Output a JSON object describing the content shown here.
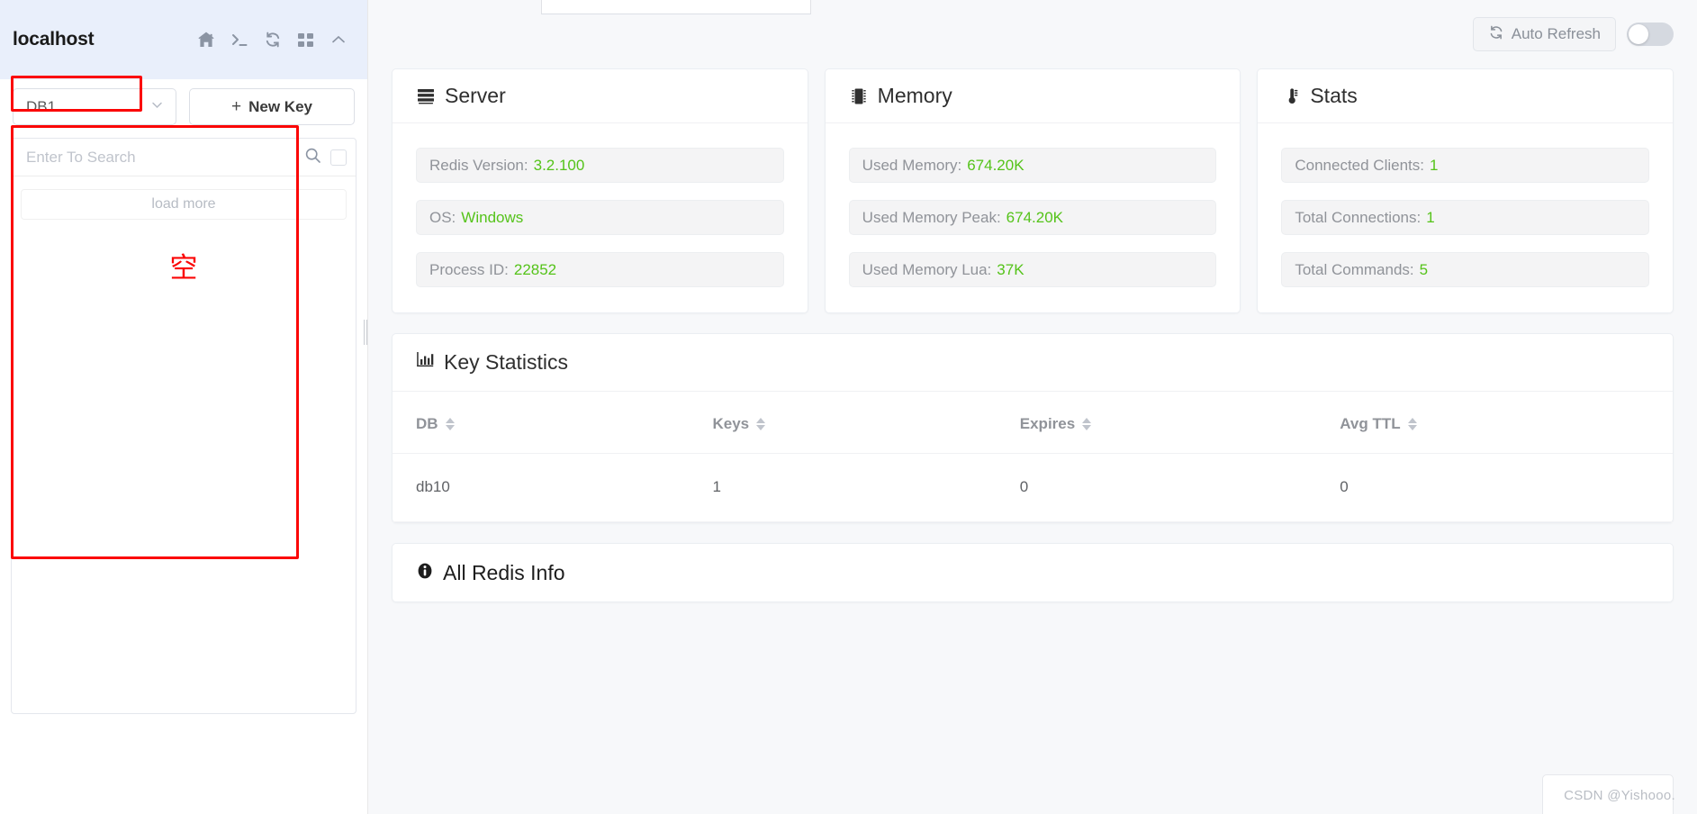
{
  "sidebar": {
    "connection_name": "localhost",
    "header_icons": [
      {
        "name": "home-icon",
        "label": "Home"
      },
      {
        "name": "terminal-icon",
        "label": "Console"
      },
      {
        "name": "refresh-icon",
        "label": "Refresh"
      },
      {
        "name": "grid-icon",
        "label": "Grid View"
      },
      {
        "name": "chevron-up-icon",
        "label": "Collapse"
      }
    ],
    "db_select_value": "DB1",
    "new_key_label": "New Key",
    "new_key_plus": "+",
    "search_placeholder": "Enter To Search",
    "load_more_label": "load more",
    "empty_marker": "空"
  },
  "topbar": {
    "auto_refresh_label": "Auto Refresh",
    "auto_refresh_on": false
  },
  "cards": [
    {
      "title": "Server",
      "icon": "server-icon",
      "rows": [
        {
          "label": "Redis Version:",
          "value": "3.2.100"
        },
        {
          "label": "OS:",
          "value": "Windows"
        },
        {
          "label": "Process ID:",
          "value": "22852"
        }
      ]
    },
    {
      "title": "Memory",
      "icon": "memory-chip-icon",
      "rows": [
        {
          "label": "Used Memory:",
          "value": "674.20K"
        },
        {
          "label": "Used Memory Peak:",
          "value": "674.20K"
        },
        {
          "label": "Used Memory Lua:",
          "value": "37K"
        }
      ]
    },
    {
      "title": "Stats",
      "icon": "thermometer-icon",
      "rows": [
        {
          "label": "Connected Clients:",
          "value": "1"
        },
        {
          "label": "Total Connections:",
          "value": "1"
        },
        {
          "label": "Total Commands:",
          "value": "5"
        }
      ]
    }
  ],
  "key_statistics": {
    "title": "Key Statistics",
    "icon": "bar-chart-icon",
    "columns": [
      "DB",
      "Keys",
      "Expires",
      "Avg TTL"
    ],
    "rows": [
      {
        "db": "db10",
        "keys": "1",
        "expires": "0",
        "avg_ttl": "0"
      }
    ]
  },
  "all_redis_info": {
    "title": "All Redis Info",
    "icon": "info-circle-icon"
  },
  "watermark": "CSDN @Yishooo.",
  "colors": {
    "accent_green": "#55c31a",
    "annotation_red": "#fb0606",
    "header_blue": "#e9effb",
    "toggle_off": "#d5d9e0"
  }
}
